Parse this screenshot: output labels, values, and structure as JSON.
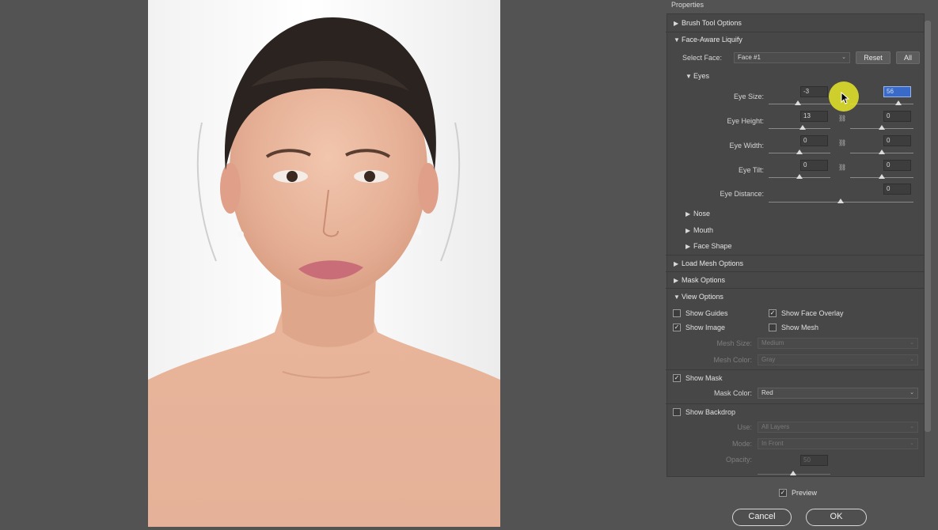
{
  "panel": {
    "title": "Properties",
    "sections": {
      "brush_tool_options": "Brush Tool Options",
      "face_aware_liquify": "Face-Aware Liquify",
      "load_mesh_options": "Load Mesh Options",
      "mask_options": "Mask Options",
      "view_options": "View Options"
    },
    "select_face": {
      "label": "Select Face:",
      "value": "Face #1",
      "reset": "Reset",
      "all": "All"
    },
    "eyes": {
      "label": "Eyes",
      "eye_size": {
        "label": "Eye Size:",
        "left": "-3",
        "right": "56"
      },
      "eye_height": {
        "label": "Eye Height:",
        "left": "13",
        "right": "0"
      },
      "eye_width": {
        "label": "Eye Width:",
        "left": "0",
        "right": "0"
      },
      "eye_tilt": {
        "label": "Eye Tilt:",
        "left": "0",
        "right": "0"
      },
      "eye_distance": {
        "label": "Eye Distance:",
        "value": "0"
      }
    },
    "nose": "Nose",
    "mouth": "Mouth",
    "face_shape": "Face Shape",
    "view": {
      "show_guides": {
        "label": "Show Guides",
        "checked": false
      },
      "show_face_overlay": {
        "label": "Show Face Overlay",
        "checked": true
      },
      "show_image": {
        "label": "Show Image",
        "checked": true
      },
      "show_mesh": {
        "label": "Show Mesh",
        "checked": false
      },
      "mesh_size": {
        "label": "Mesh Size:",
        "value": "Medium"
      },
      "mesh_color": {
        "label": "Mesh Color:",
        "value": "Gray"
      },
      "show_mask": {
        "label": "Show Mask",
        "checked": true
      },
      "mask_color": {
        "label": "Mask Color:",
        "value": "Red"
      },
      "show_backdrop": {
        "label": "Show Backdrop",
        "checked": false
      },
      "use": {
        "label": "Use:",
        "value": "All Layers"
      },
      "mode": {
        "label": "Mode:",
        "value": "In Front"
      },
      "opacity": {
        "label": "Opacity:",
        "value": "50"
      }
    },
    "preview": {
      "label": "Preview",
      "checked": true
    },
    "cancel": "Cancel",
    "ok": "OK"
  },
  "icons": {
    "check": "✓",
    "triangle_right": "▶",
    "triangle_down": "▼",
    "chevron": "⌄",
    "link": "chain-link-icon"
  }
}
